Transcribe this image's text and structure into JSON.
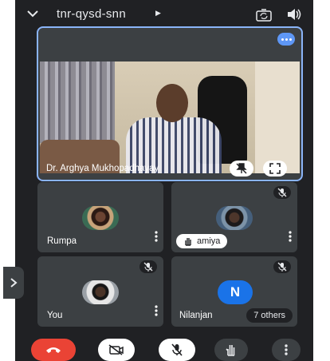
{
  "top_bar": {
    "meeting_code": "tnr-qysd-snn",
    "collapse_icon": "chevron-down-icon",
    "info_icon": "play-right-icon",
    "switch_camera_icon": "switch-camera-icon",
    "audio_icon": "speaker-icon"
  },
  "main_tile": {
    "name": "Dr. Arghya Mukhopadhayay",
    "speaking_icon": "speaking-dots-icon",
    "pin_icon": "unpin-icon",
    "fullscreen_icon": "fullscreen-icon"
  },
  "tiles": [
    {
      "name": "Rumpa",
      "muted": false
    },
    {
      "name": "amiya",
      "muted": true,
      "hand_raised": true
    },
    {
      "name": "You",
      "muted": true
    },
    {
      "name": "Nilanjan",
      "initial": "N",
      "muted": true,
      "others_label": "7 others"
    }
  ],
  "side_panel": {
    "icon": "chevron-right-icon"
  },
  "controls": [
    {
      "id": "end-call",
      "icon": "phone-end-icon",
      "color": "#ea4335"
    },
    {
      "id": "camera",
      "icon": "camera-off-icon"
    },
    {
      "id": "microphone",
      "icon": "mic-off-icon"
    },
    {
      "id": "raise-hand",
      "icon": "hand-icon"
    },
    {
      "id": "more",
      "icon": "more-vert-icon"
    }
  ],
  "colors": {
    "background": "#202124",
    "tile": "#3c4043",
    "accent": "#8ab4f8",
    "avatar_blue": "#1a73e8",
    "danger": "#ea4335"
  }
}
